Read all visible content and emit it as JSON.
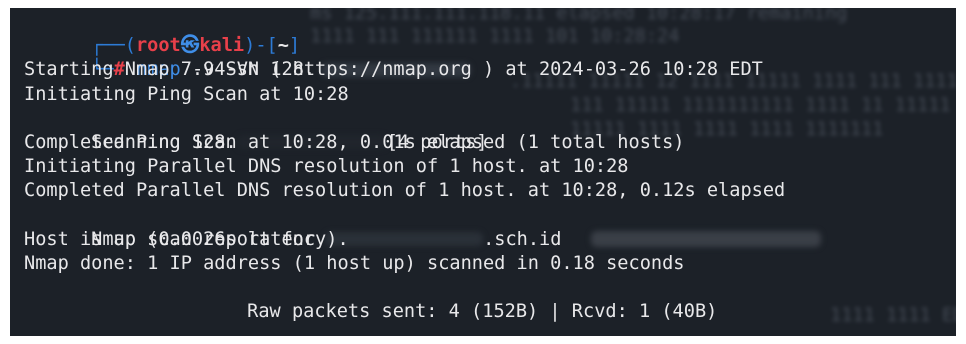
{
  "prompt": {
    "frame_top": "┌──(",
    "user": "root",
    "skull": "㉿",
    "host": "kali",
    "frame_mid": ")-[",
    "dir": "~",
    "frame_end": "]",
    "frame_bottom": "└─",
    "hash": "#",
    "command_name": "nmap",
    "command_args": " -v -sn 128."
  },
  "output": {
    "starting": "Starting Nmap 7.94SVN ( https://nmap.org ) at 2024-03-26 10:28 EDT",
    "init_ping": "Initiating Ping Scan at 10:28",
    "scanning_prefix": "Scanning 128.",
    "scanning_suffix": "[4 ports]",
    "completed_ping": "Completed Ping Scan at 10:28, 0.01s elapsed (1 total hosts)",
    "init_dns": "Initiating Parallel DNS resolution of 1 host. at 10:28",
    "completed_dns": "Completed Parallel DNS resolution of 1 host. at 10:28, 0.12s elapsed",
    "report_prefix": "Nmap scan report for",
    "report_suffix": ".sch.id",
    "host_up": "Host is up (0.0026s latency).",
    "done": "Nmap done: 1 IP address (1 host up) scanned in 0.18 seconds",
    "raw_packets": "Raw packets sent: 4 (152B) | Rcvd: 1 (40B)"
  },
  "colors": {
    "background": "#1c2128",
    "text": "#e8e8ea",
    "prompt_blue": "#2d7bd6",
    "prompt_red": "#e8404a"
  }
}
